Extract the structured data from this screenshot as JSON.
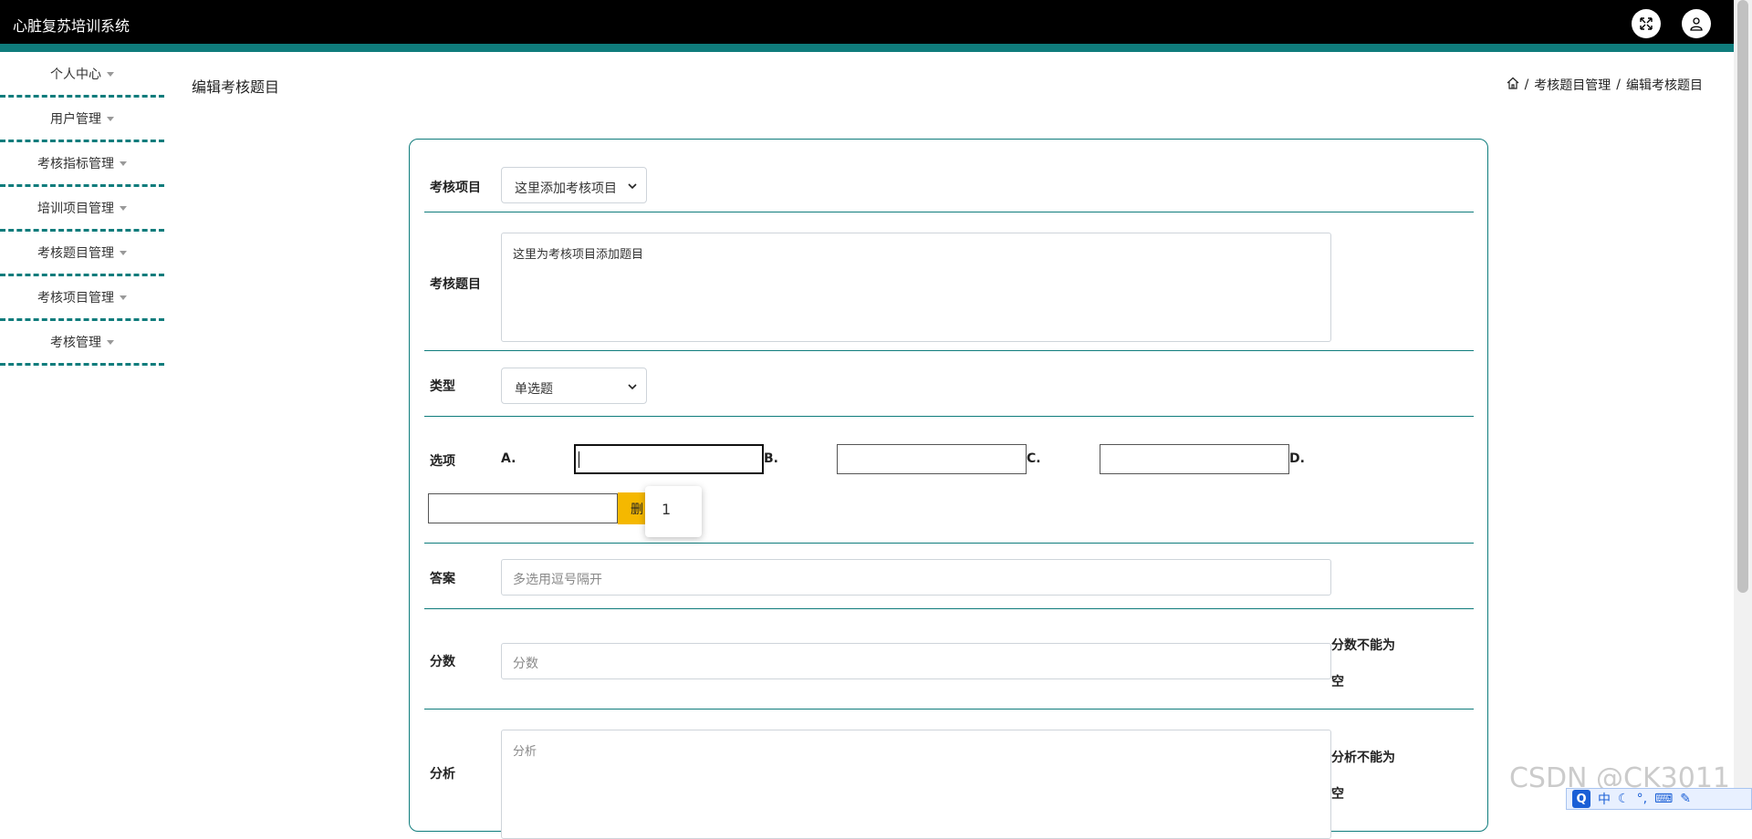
{
  "app": {
    "title": "心脏复苏培训系统"
  },
  "sidebar": {
    "items": [
      {
        "label": "个人中心"
      },
      {
        "label": "用户管理"
      },
      {
        "label": "考核指标管理"
      },
      {
        "label": "培训项目管理"
      },
      {
        "label": "考核题目管理"
      },
      {
        "label": "考核项目管理"
      },
      {
        "label": "考核管理"
      }
    ]
  },
  "page": {
    "title": "编辑考核题目",
    "breadcrumb": [
      "考核题目管理",
      "编辑考核题目"
    ],
    "breadcrumb_sep": "/"
  },
  "form": {
    "project": {
      "label": "考核项目",
      "value": "这里添加考核项目"
    },
    "question": {
      "label": "考核题目",
      "value": "这里为考核项目添加题目"
    },
    "type": {
      "label": "类型",
      "value": "单选题"
    },
    "options": {
      "label": "选项",
      "letters": [
        "A.",
        "B.",
        "C.",
        "D."
      ],
      "delete_label": "删",
      "popup_value": "1"
    },
    "answer": {
      "label": "答案",
      "placeholder": "多选用逗号隔开"
    },
    "score": {
      "label": "分数",
      "placeholder": "分数",
      "error": "分数不能为空"
    },
    "analysis": {
      "label": "分析",
      "placeholder": "分析",
      "error": "分析不能为空"
    }
  },
  "watermark": "CSDN @CK3011",
  "ime": {
    "lang": "中",
    "logo": "Q"
  },
  "colors": {
    "accent": "#0f7c7c",
    "topbar": "#000000",
    "warning": "#f5b800"
  }
}
